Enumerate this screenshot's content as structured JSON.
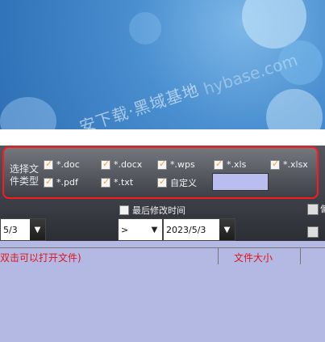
{
  "watermark": {
    "text_cn": "安下载·黑域基地",
    "text_en": "hybase.com"
  },
  "filter": {
    "label": "选择文件类型",
    "options": [
      {
        "label": "*.doc",
        "checked": true
      },
      {
        "label": "*.docx",
        "checked": true
      },
      {
        "label": "*.wps",
        "checked": true
      },
      {
        "label": "*.xls",
        "checked": true
      },
      {
        "label": "*.xlsx",
        "checked": true
      },
      {
        "label": "*.pdf",
        "checked": true
      },
      {
        "label": "*.txt",
        "checked": true
      },
      {
        "label": "自定义",
        "checked": true
      }
    ],
    "custom_value": "",
    "highlight_color": "#ff1a1a"
  },
  "time_filter": {
    "label": "最后修改时间",
    "checked": false,
    "left_date": "5/3",
    "operator": ">",
    "date": "2023/5/3"
  },
  "grid": {
    "columns": [
      "双击可以打开文件)",
      "文件大小",
      ""
    ],
    "header_color": "#e0151d"
  },
  "right_edge_glyph": "偏"
}
